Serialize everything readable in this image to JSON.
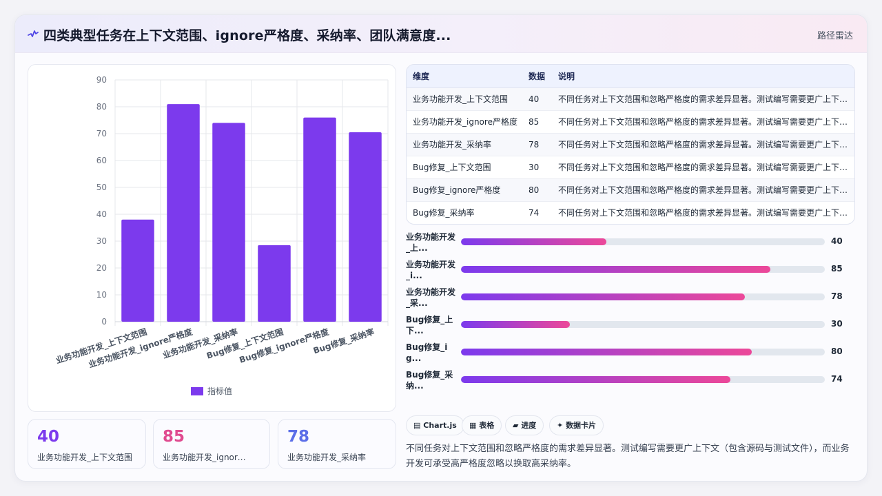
{
  "header": {
    "title": "四类典型任务在上下文范围、ignore严格度、采纳率、团队满意度...",
    "link": "路径雷达",
    "icon": "pulse-icon"
  },
  "chart_data": {
    "type": "bar",
    "categories": [
      "业务功能开发_上下文范围",
      "业务功能开发_ignore严格度",
      "业务功能开发_采纳率",
      "Bug修复_上下文范围",
      "Bug修复_ignore严格度",
      "Bug修复_采纳率"
    ],
    "series": [
      {
        "name": "指标值",
        "values": [
          38,
          81,
          74,
          28.5,
          76,
          70.5
        ]
      }
    ],
    "ylim": [
      0,
      90
    ],
    "yticks": [
      0,
      10,
      20,
      30,
      40,
      50,
      60,
      70,
      80,
      90
    ],
    "grid": true,
    "legend": "bottom",
    "bar_color": "#7c3aed"
  },
  "kpis": [
    {
      "value": "40",
      "label": "业务功能开发_上下文范围",
      "color": "#7c3aed"
    },
    {
      "value": "85",
      "label": "业务功能开发_ignore严格度",
      "color": "#e04a8f"
    },
    {
      "value": "78",
      "label": "业务功能开发_采纳率",
      "color": "#5b6ee8"
    }
  ],
  "table": {
    "headers": [
      "维度",
      "数据",
      "说明"
    ],
    "rows": [
      {
        "dim": "业务功能开发_上下文范围",
        "val": "40",
        "desc": "不同任务对上下文范围和忽略严格度的需求差异显著。测试编写需要更广上下文（包含源码与测试文件），而业务开发可承受高严格度忽略以换取高采纳率。"
      },
      {
        "dim": "业务功能开发_ignore严格度",
        "val": "85",
        "desc": "不同任务对上下文范围和忽略严格度的需求差异显著。测试编写需要更广上下文（包含源码与测试文件），而业务开发可承受高严格度忽略以换取高采纳率。"
      },
      {
        "dim": "业务功能开发_采纳率",
        "val": "78",
        "desc": "不同任务对上下文范围和忽略严格度的需求差异显著。测试编写需要更广上下文（包含源码与测试文件），而业务开发可承受高严格度忽略以换取高采纳率。"
      },
      {
        "dim": "Bug修复_上下文范围",
        "val": "30",
        "desc": "不同任务对上下文范围和忽略严格度的需求差异显著。测试编写需要更广上下文（包含源码与测试文件），而业务开发可承受高严格度忽略以换取高采纳率。"
      },
      {
        "dim": "Bug修复_ignore严格度",
        "val": "80",
        "desc": "不同任务对上下文范围和忽略严格度的需求差异显著。测试编写需要更广上下文（包含源码与测试文件），而业务开发可承受高严格度忽略以换取高采纳率。"
      },
      {
        "dim": "Bug修复_采纳率",
        "val": "74",
        "desc": "不同任务对上下文范围和忽略严格度的需求差异显著。测试编写需要更广上下文（包含源码与测试文件），而业务开发可承受高严格度忽略以换取高采纳率。"
      }
    ]
  },
  "progress": {
    "max": 100,
    "items": [
      {
        "label": "业务功能开发_上...",
        "value": 40
      },
      {
        "label": "业务功能开发_i...",
        "value": 85
      },
      {
        "label": "业务功能开发_采...",
        "value": 78
      },
      {
        "label": "Bug修复_上下...",
        "value": 30
      },
      {
        "label": "Bug修复_ig...",
        "value": 80
      },
      {
        "label": "Bug修复_采纳...",
        "value": 74
      }
    ]
  },
  "chips": [
    {
      "icon": "chart-icon",
      "glyph": "▤",
      "label": "Chart.js"
    },
    {
      "icon": "table-icon",
      "glyph": "▦",
      "label": "表格"
    },
    {
      "icon": "progress-icon",
      "glyph": "▰",
      "label": "进度"
    },
    {
      "icon": "card-icon",
      "glyph": "✦",
      "label": "数据卡片"
    }
  ],
  "summary": "不同任务对上下文范围和忽略严格度的需求差异显著。测试编写需要更广上下文（包含源码与测试文件），而业务开发可承受高严格度忽略以换取高采纳率。"
}
